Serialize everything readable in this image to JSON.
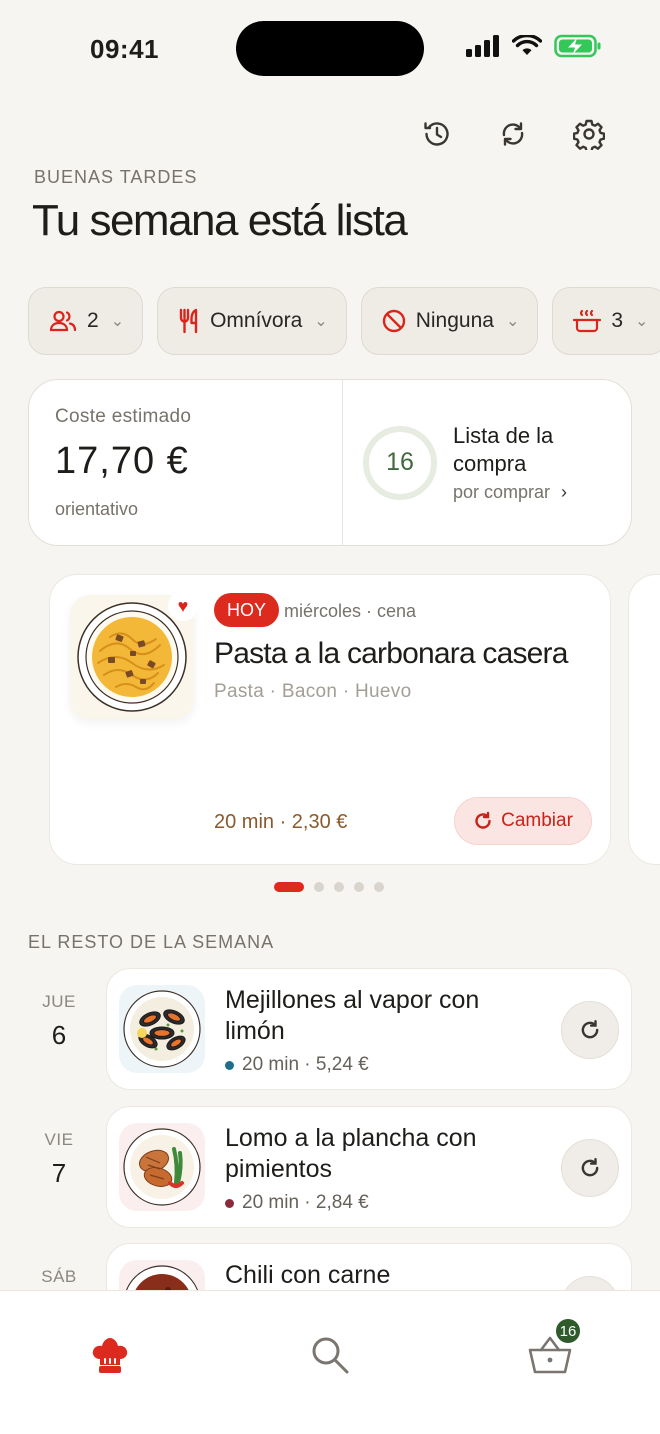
{
  "status_bar": {
    "time": "09:41"
  },
  "header": {
    "greeting": "BUENAS TARDES",
    "title": "Tu semana está lista",
    "actions": [
      "history-icon",
      "refresh-icon",
      "settings-icon"
    ]
  },
  "filters": [
    {
      "value": "2",
      "icon": "people-icon"
    },
    {
      "value": "Omnívora",
      "icon": "utensils-icon"
    },
    {
      "value": "Ninguna",
      "icon": "prohibited-icon"
    },
    {
      "value": "3",
      "icon": "pot-icon"
    }
  ],
  "summary": {
    "cost_label": "Coste estimado",
    "cost_value": "17,70 €",
    "cost_note": "orientativo",
    "list_count": "16",
    "list_title": "Lista de la compra",
    "list_sub": "por comprar"
  },
  "hero": {
    "badge": "HOY",
    "when": "miércoles · cena",
    "title": "Pasta a la carbonara casera",
    "tags": "Pasta · Bacon · Huevo",
    "meta": "20 min · 2,30 €",
    "change_label": "Cambiar",
    "favorite": true
  },
  "carousel": {
    "pages": 5,
    "active": 1
  },
  "week": {
    "label": "EL RESTO DE LA SEMANA",
    "items": [
      {
        "day": "JUE",
        "num": "6",
        "title": "Mejillones al vapor con limón",
        "meta": "20 min · 5,24 €",
        "dot_color": "#1f6f8b"
      },
      {
        "day": "VIE",
        "num": "7",
        "title": "Lomo a la plancha con pimientos",
        "meta": "20 min · 2,84 €",
        "dot_color": "#8b2a3a"
      },
      {
        "day": "SÁB",
        "num": "",
        "title": "Chili con carne",
        "meta": "",
        "dot_color": "#8b2a3a"
      }
    ]
  },
  "bottom_nav": {
    "items": [
      "chef-hat-icon",
      "search-icon",
      "basket-icon"
    ],
    "cart_count": "16"
  },
  "colors": {
    "accent": "#dc2a1e",
    "green": "#2f5a2c",
    "background": "#f7f5f1"
  }
}
